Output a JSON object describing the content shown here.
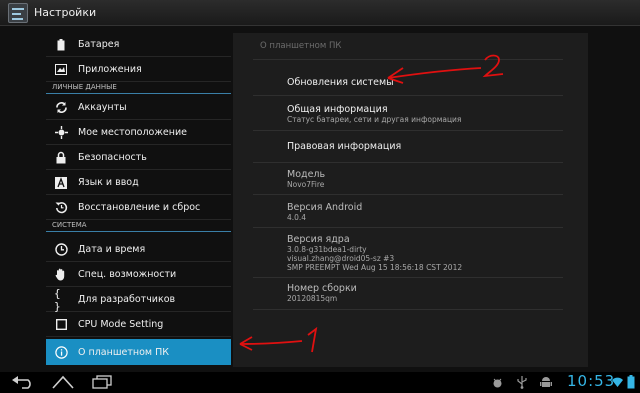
{
  "actionbar": {
    "title": "Настройки",
    "icon": "settings-app-icon"
  },
  "sidebar": {
    "items": [
      {
        "type": "item",
        "label": "Батарея",
        "icon": "battery-icon"
      },
      {
        "type": "item",
        "label": "Приложения",
        "icon": "apps-icon"
      },
      {
        "type": "section",
        "label": "ЛИЧНЫЕ ДАННЫЕ"
      },
      {
        "type": "item",
        "label": "Аккаунты",
        "icon": "sync-icon"
      },
      {
        "type": "item",
        "label": "Мое местоположение",
        "icon": "location-icon"
      },
      {
        "type": "item",
        "label": "Безопасность",
        "icon": "lock-icon"
      },
      {
        "type": "item",
        "label": "Язык и ввод",
        "icon": "language-icon"
      },
      {
        "type": "item",
        "label": "Восстановление и сброс",
        "icon": "restore-icon"
      },
      {
        "type": "section",
        "label": "СИСТЕМА"
      },
      {
        "type": "item",
        "label": "Дата и время",
        "icon": "clock-icon"
      },
      {
        "type": "item",
        "label": "Спец. возможности",
        "icon": "hand-icon"
      },
      {
        "type": "item",
        "label": "Для разработчиков",
        "icon": "braces-icon"
      },
      {
        "type": "item",
        "label": "CPU Mode Setting",
        "icon": "square-icon"
      },
      {
        "type": "item",
        "label": "О планшетном ПК",
        "icon": "info-icon",
        "selected": true
      }
    ]
  },
  "detail": {
    "title": "О планшетном ПК",
    "entries": [
      {
        "title": "Обновления системы",
        "summary": []
      },
      {
        "title": "Общая информация",
        "summary": [
          "Статус батареи, сети и другая информация"
        ]
      },
      {
        "title": "Правовая информация",
        "summary": []
      },
      {
        "title": "Модель",
        "summary": [
          "Novo7Fire"
        ],
        "dim": true
      },
      {
        "title": "Версия Android",
        "summary": [
          "4.0.4"
        ],
        "dim": true
      },
      {
        "title": "Версия ядра",
        "summary": [
          "3.0.8-g31bdea1-dirty",
          "visual.zhang@droid05-sz #3",
          "SMP PREEMPT Wed Aug 15 18:56:18 CST 2012"
        ],
        "dim": true
      },
      {
        "title": "Номер сборки",
        "summary": [
          "20120815qm"
        ],
        "dim": true
      }
    ]
  },
  "annotations": {
    "arrow1_label": "1",
    "arrow2_label": "2",
    "color": "#e01010"
  },
  "systembar": {
    "time": "10:53",
    "buttons": [
      "back-icon",
      "home-icon",
      "recent-apps-icon"
    ],
    "status_icons": [
      "android-debug-icon",
      "usb-icon",
      "android-icon",
      "wifi-icon",
      "battery-status-icon"
    ],
    "accent": "#35b5e5"
  },
  "colors": {
    "selected": "#1a8fc3",
    "section_rule": "#3a7fa7"
  }
}
